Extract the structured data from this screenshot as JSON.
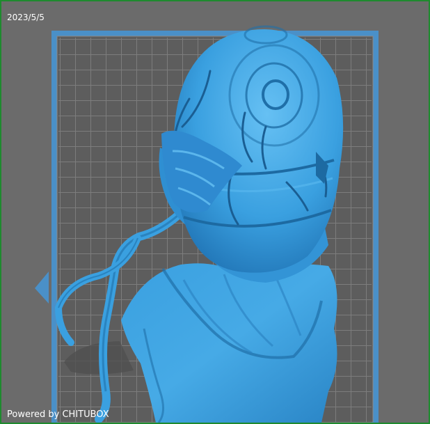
{
  "viewer": {
    "date": "2023/5/5",
    "watermark": "Powered by CHITUBOX"
  },
  "colors": {
    "background": "#6b6b6b",
    "frame_border": "#1e8a2e",
    "build_plate_border": "#4a90c8",
    "build_plate_fill": "#5d5d5d",
    "grid_line": "#7a7a7a",
    "model": "#3aa0e0",
    "model_shade": "#1f6fa8",
    "model_highlight": "#6cc4f5",
    "shadow": "#505050"
  },
  "icons": {
    "model": "3d-model-bust",
    "build_plate": "build-plate-grid"
  }
}
